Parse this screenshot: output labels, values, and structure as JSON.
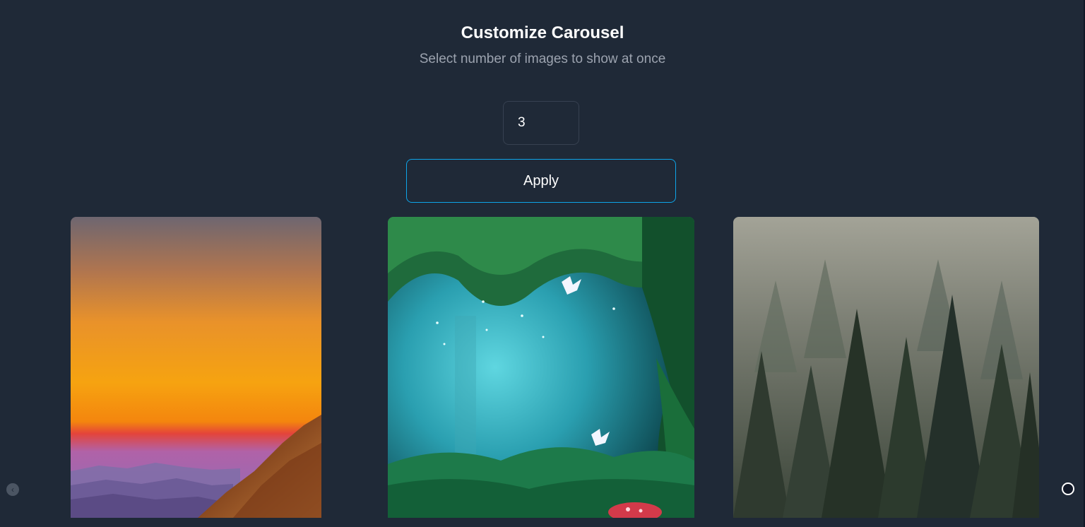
{
  "header": {
    "title": "Customize Carousel",
    "subtitle": "Select number of images to show at once"
  },
  "controls": {
    "count_value": "3",
    "apply_label": "Apply"
  },
  "carousel": {
    "slides": [
      {
        "subject": "sunset-mountain"
      },
      {
        "subject": "fantasy-forest-butterflies"
      },
      {
        "subject": "misty-pine-forest"
      }
    ],
    "prev_icon": "chevron-left-icon",
    "next_icon": "circle-icon"
  },
  "colors": {
    "background": "#1f2937",
    "accent": "#0ea5e9",
    "text": "#ffffff",
    "muted_text": "#9ca3af"
  }
}
